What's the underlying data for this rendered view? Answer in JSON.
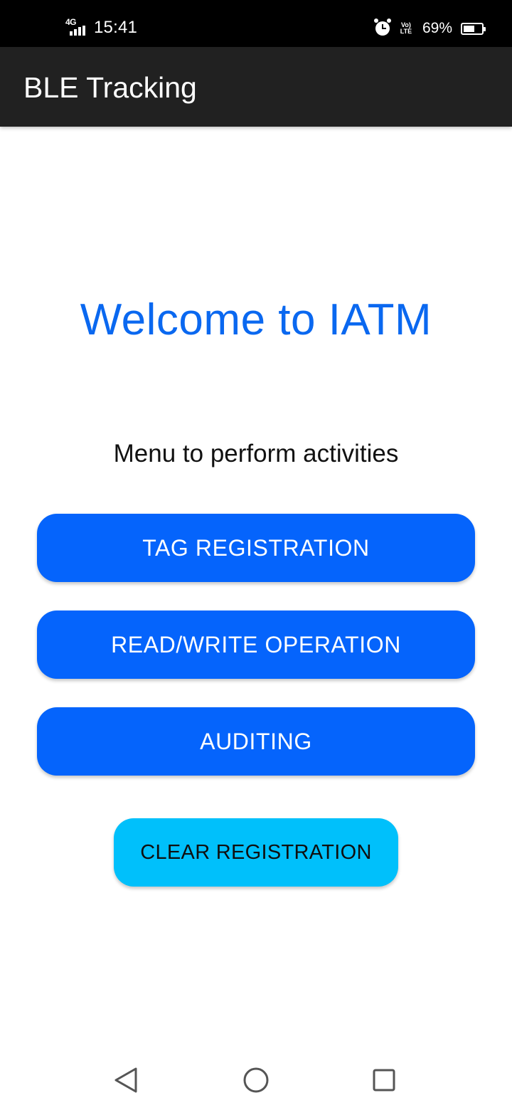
{
  "status_bar": {
    "network_label": "4G",
    "time": "15:41",
    "volte_label": "Vo) LTE",
    "battery_percent": "69%",
    "battery_level": 0.69,
    "icons": [
      "signal-icon",
      "alarm-icon",
      "volte-icon",
      "battery-icon"
    ]
  },
  "app_bar": {
    "title": "BLE Tracking"
  },
  "main": {
    "welcome": "Welcome to IATM",
    "subtitle": "Menu to perform activities",
    "buttons": {
      "tag_registration": "TAG REGISTRATION",
      "read_write": "READ/WRITE OPERATION",
      "auditing": "AUDITING",
      "clear_registration": "CLEAR REGISTRATION"
    }
  },
  "nav_bar": {
    "icons": [
      "back-icon",
      "home-icon",
      "recent-apps-icon"
    ]
  },
  "colors": {
    "app_bar": "#212121",
    "primary_button": "#0564fc",
    "secondary_button": "#00c0fb",
    "welcome_text": "#0a68f0"
  }
}
